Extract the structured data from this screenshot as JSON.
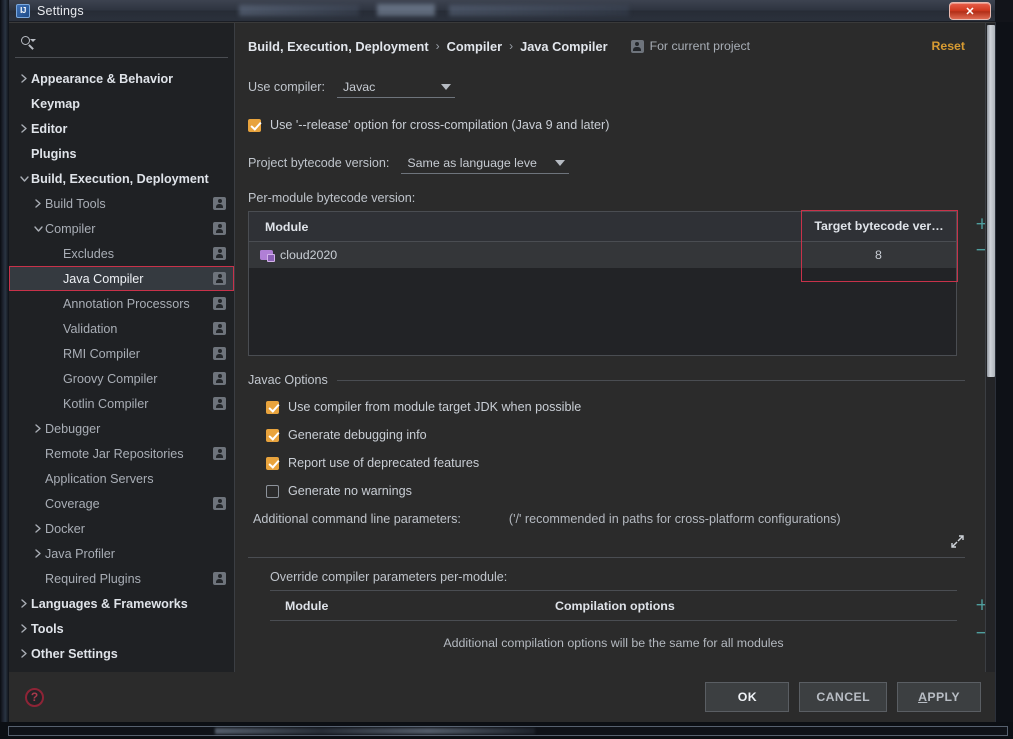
{
  "window": {
    "title": "Settings",
    "app_icon": "intellij-idea-icon",
    "close_label": "✕"
  },
  "search": {
    "value": "",
    "placeholder": "",
    "icon": "search-icon"
  },
  "sidebar": {
    "items": [
      {
        "label": "Appearance & Behavior",
        "level": 0,
        "arrow": "right",
        "badge": false
      },
      {
        "label": "Keymap",
        "level": 0,
        "arrow": "none",
        "badge": false
      },
      {
        "label": "Editor",
        "level": 0,
        "arrow": "right",
        "badge": false
      },
      {
        "label": "Plugins",
        "level": 0,
        "arrow": "none",
        "badge": false
      },
      {
        "label": "Build, Execution, Deployment",
        "level": 0,
        "arrow": "down",
        "badge": false
      },
      {
        "label": "Build Tools",
        "level": 1,
        "arrow": "right",
        "badge": true
      },
      {
        "label": "Compiler",
        "level": 1,
        "arrow": "down",
        "badge": true
      },
      {
        "label": "Excludes",
        "level": 2,
        "arrow": "none",
        "badge": true
      },
      {
        "label": "Java Compiler",
        "level": 2,
        "arrow": "none",
        "badge": true,
        "selected": true
      },
      {
        "label": "Annotation Processors",
        "level": 2,
        "arrow": "none",
        "badge": true
      },
      {
        "label": "Validation",
        "level": 2,
        "arrow": "none",
        "badge": true
      },
      {
        "label": "RMI Compiler",
        "level": 2,
        "arrow": "none",
        "badge": true
      },
      {
        "label": "Groovy Compiler",
        "level": 2,
        "arrow": "none",
        "badge": true
      },
      {
        "label": "Kotlin Compiler",
        "level": 2,
        "arrow": "none",
        "badge": true
      },
      {
        "label": "Debugger",
        "level": 1,
        "arrow": "right",
        "badge": false
      },
      {
        "label": "Remote Jar Repositories",
        "level": 1,
        "arrow": "none",
        "badge": true
      },
      {
        "label": "Application Servers",
        "level": 1,
        "arrow": "none",
        "badge": false
      },
      {
        "label": "Coverage",
        "level": 1,
        "arrow": "none",
        "badge": true
      },
      {
        "label": "Docker",
        "level": 1,
        "arrow": "right",
        "badge": false
      },
      {
        "label": "Java Profiler",
        "level": 1,
        "arrow": "right",
        "badge": false
      },
      {
        "label": "Required Plugins",
        "level": 1,
        "arrow": "none",
        "badge": true
      },
      {
        "label": "Languages & Frameworks",
        "level": 0,
        "arrow": "right",
        "badge": false
      },
      {
        "label": "Tools",
        "level": 0,
        "arrow": "right",
        "badge": false
      },
      {
        "label": "Other Settings",
        "level": 0,
        "arrow": "right",
        "badge": false
      }
    ]
  },
  "header": {
    "breadcrumb": [
      "Build, Execution, Deployment",
      "Compiler",
      "Java Compiler"
    ],
    "separator": "›",
    "scope_label": "For current project",
    "scope_icon": "project-scope-icon",
    "reset_label": "Reset",
    "reset_color": "#d79b32"
  },
  "compiler": {
    "use_compiler_label": "Use compiler:",
    "use_compiler_value": "Javac",
    "release_option_label": "Use '--release' option for cross-compilation (Java 9 and later)",
    "release_option_checked": true,
    "project_bytecode_label": "Project bytecode version:",
    "project_bytecode_value": "Same as language leve",
    "per_module_label": "Per-module bytecode version:"
  },
  "module_table": {
    "columns": [
      "Module",
      "Target bytecode ver…"
    ],
    "rows": [
      {
        "module": "cloud2020",
        "module_icon": "module-folder-icon",
        "target_bytecode": "8"
      }
    ],
    "add_label": "+",
    "remove_label": "−",
    "annotation_color": "#c8324a"
  },
  "javac_options": {
    "section_title": "Javac Options",
    "checkboxes": [
      {
        "label": "Use compiler from module target JDK when possible",
        "checked": true
      },
      {
        "label": "Generate debugging info",
        "checked": true
      },
      {
        "label": "Report use of deprecated features",
        "checked": true
      },
      {
        "label": "Generate no warnings",
        "checked": false
      }
    ],
    "additional_params_label": "Additional command line parameters:",
    "additional_params_hint": "('/' recommended in paths for cross-platform configurations)",
    "additional_params_value": "",
    "expand_icon": "expand-diagonal-icon"
  },
  "override_table": {
    "title": "Override compiler parameters per-module:",
    "columns": [
      "Module",
      "Compilation options"
    ],
    "empty_text": "Additional compilation options will be the same for all modules",
    "add_label": "+",
    "remove_label": "−"
  },
  "footer": {
    "help_label": "?",
    "buttons": [
      {
        "label": "OK",
        "default": true
      },
      {
        "label": "CANCEL",
        "default": false
      },
      {
        "label": "APPLY",
        "default": false,
        "mnemonic": "A"
      }
    ]
  }
}
